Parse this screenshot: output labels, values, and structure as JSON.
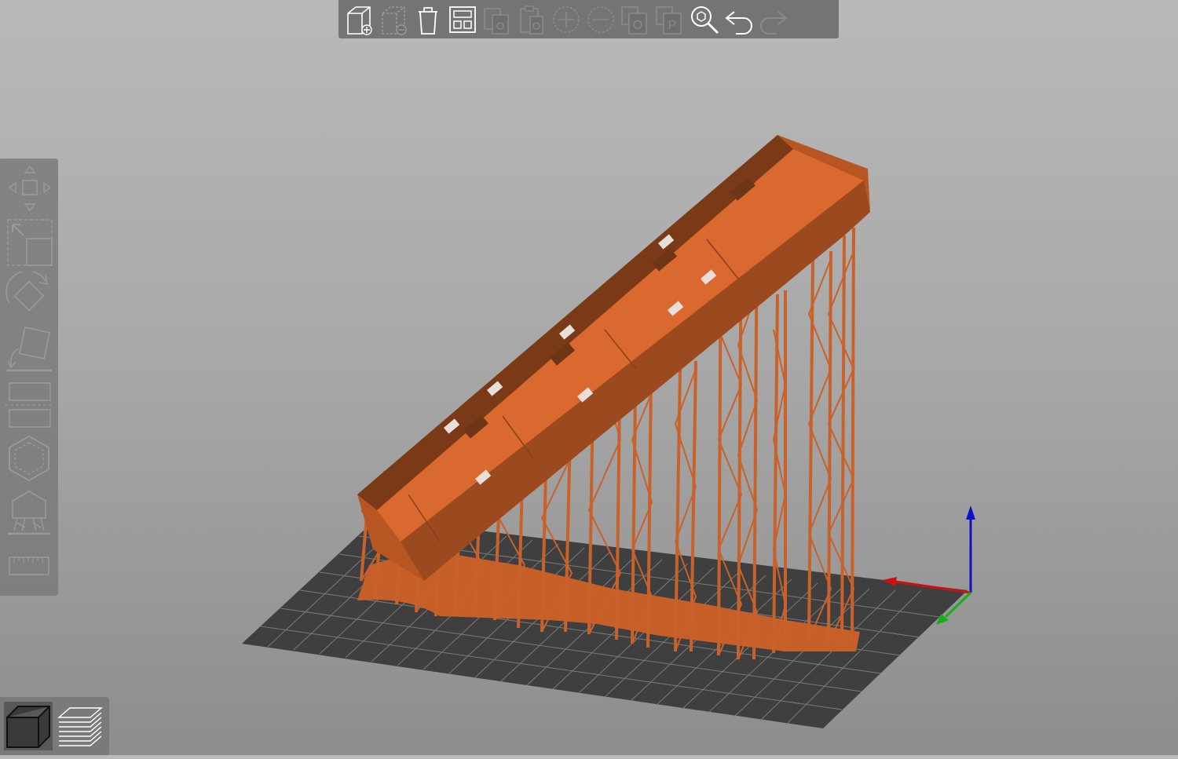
{
  "app": {
    "theme": {
      "background_top": "#b9b9b9",
      "background_bottom": "#8d8d8d",
      "model_color": "#c9622a",
      "bed_color": "#3f3f3f"
    }
  },
  "top_toolbar": {
    "buttons": [
      {
        "name": "add-icon",
        "enabled": true
      },
      {
        "name": "delete-icon",
        "enabled": false
      },
      {
        "name": "delete-all-icon",
        "enabled": true
      },
      {
        "name": "arrange-icon",
        "enabled": true
      },
      {
        "name": "copy-icon",
        "enabled": false
      },
      {
        "name": "paste-icon",
        "enabled": false
      },
      {
        "name": "add-instance-icon",
        "enabled": false
      },
      {
        "name": "remove-instance-icon",
        "enabled": false
      },
      {
        "name": "split-to-objects-icon",
        "enabled": false
      },
      {
        "name": "split-to-parts-icon",
        "enabled": false
      },
      {
        "name": "search-icon",
        "enabled": true
      },
      {
        "name": "undo-icon",
        "enabled": true
      },
      {
        "name": "redo-icon",
        "enabled": false
      }
    ],
    "split_objects_letter": "O",
    "split_parts_letter": "P"
  },
  "left_toolbar": {
    "tools": [
      "move-icon",
      "scale-icon",
      "rotate-icon",
      "place-on-face-icon",
      "cut-icon",
      "hollow-icon",
      "sla-support-points-icon",
      "measure-icon"
    ]
  },
  "view_toggle": {
    "items": [
      {
        "name": "3d-view-icon",
        "active": true
      },
      {
        "name": "preview-layers-icon",
        "active": false
      }
    ]
  },
  "axes": {
    "x_color": "#d01010",
    "y_color": "#16b016",
    "z_color": "#1010c8"
  }
}
